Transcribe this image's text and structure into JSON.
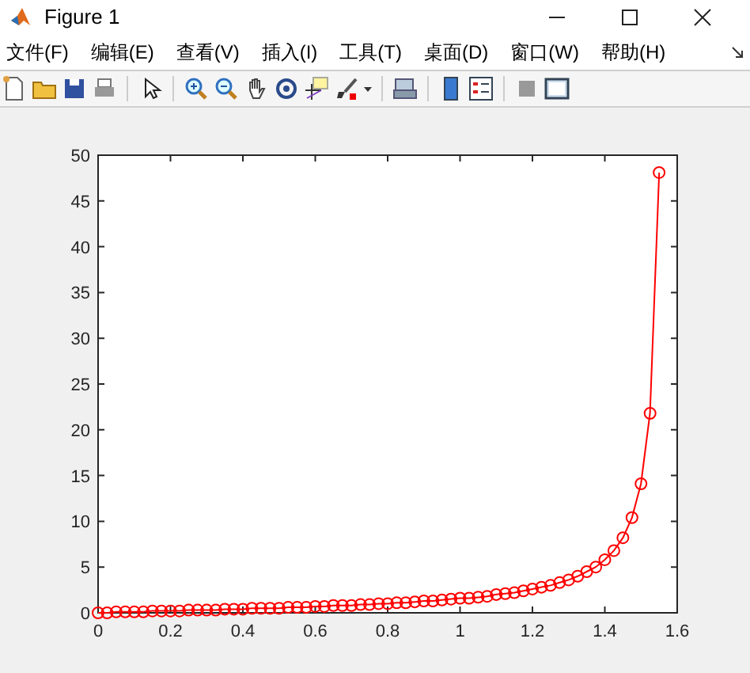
{
  "window": {
    "title": "Figure 1"
  },
  "menu": [
    "文件(F)",
    "编辑(E)",
    "查看(V)",
    "插入(I)",
    "工具(T)",
    "桌面(D)",
    "窗口(W)",
    "帮助(H)"
  ],
  "plot": {
    "chart_data": {
      "type": "line",
      "x": [
        0,
        0.025,
        0.05,
        0.075,
        0.1,
        0.125,
        0.15,
        0.175,
        0.2,
        0.225,
        0.25,
        0.275,
        0.3,
        0.325,
        0.35,
        0.375,
        0.4,
        0.425,
        0.45,
        0.475,
        0.5,
        0.525,
        0.55,
        0.575,
        0.6,
        0.625,
        0.65,
        0.675,
        0.7,
        0.725,
        0.75,
        0.775,
        0.8,
        0.825,
        0.85,
        0.875,
        0.9,
        0.925,
        0.95,
        0.975,
        1,
        1.025,
        1.05,
        1.075,
        1.1,
        1.125,
        1.15,
        1.175,
        1.2,
        1.225,
        1.25,
        1.275,
        1.3,
        1.325,
        1.35,
        1.375,
        1.4,
        1.425,
        1.45,
        1.475,
        1.5,
        1.525,
        1.55
      ],
      "series": [
        {
          "color": "#ff0000",
          "marker": "o",
          "values": [
            0,
            0,
            0.1,
            0.1,
            0.1,
            0.1,
            0.2,
            0.2,
            0.2,
            0.2,
            0.3,
            0.3,
            0.3,
            0.3,
            0.4,
            0.4,
            0.4,
            0.5,
            0.5,
            0.5,
            0.5,
            0.6,
            0.6,
            0.6,
            0.7,
            0.7,
            0.8,
            0.8,
            0.8,
            0.9,
            0.9,
            1,
            1,
            1.1,
            1.1,
            1.2,
            1.3,
            1.3,
            1.4,
            1.5,
            1.6,
            1.6,
            1.7,
            1.8,
            2,
            2.1,
            2.2,
            2.4,
            2.6,
            2.8,
            3,
            3.3,
            3.6,
            4,
            4.5,
            5,
            5.8,
            6.8,
            8.2,
            10.4,
            14.1,
            21.8,
            48.1
          ]
        }
      ],
      "xlim": [
        0,
        1.6
      ],
      "ylim": [
        0,
        50
      ],
      "xticks": [
        0,
        {
          "value": 0.2,
          "label": "0.2"
        },
        {
          "value": 0.4,
          "label": "0.4"
        },
        {
          "value": 0.6,
          "label": "0.6"
        },
        {
          "value": 0.8,
          "label": "0.8"
        },
        1,
        {
          "value": 1.2,
          "label": "1.2"
        },
        {
          "value": 1.4,
          "label": "1.4"
        },
        {
          "value": 1.6,
          "label": "1.6"
        }
      ],
      "yticks": [
        0,
        5,
        10,
        15,
        20,
        25,
        30,
        35,
        40,
        45,
        50
      ]
    }
  }
}
